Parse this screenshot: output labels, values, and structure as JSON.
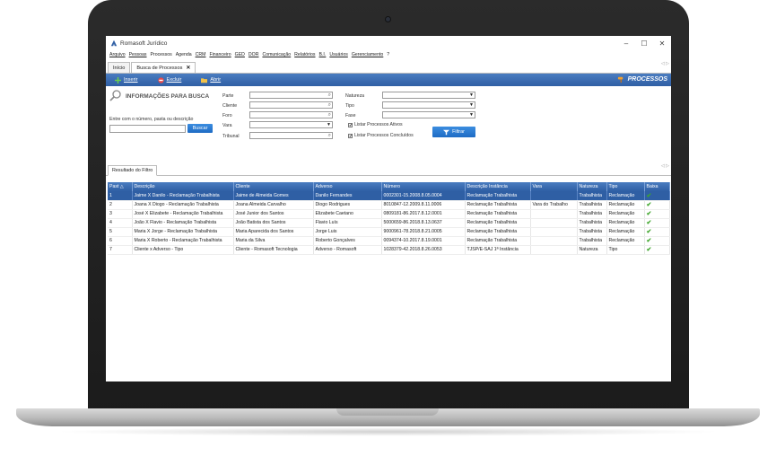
{
  "app": {
    "title": "Romasoft Jurídico",
    "window_buttons": [
      "–",
      "☐",
      "✕"
    ]
  },
  "menu": [
    "Arquivo",
    "Pessoas",
    "Processos",
    "Agenda",
    "CRM",
    "Financeiro",
    "GED",
    "DOR",
    "Comunicação",
    "Relatórios",
    "B.I.",
    "Usuários",
    "Gerenciamento",
    "?"
  ],
  "tabs": {
    "home": "Início",
    "active": "Busca de Processos",
    "close": "✕",
    "arrows": "◁ ▷"
  },
  "toolbar": {
    "insert": "Inserir",
    "delete": "Excluir",
    "open": "Abrir",
    "module": "PROCESSOS"
  },
  "search": {
    "title": "INFORMAÇÕES PARA BUSCA",
    "hint": "Entre com o número, pasta ou descrição",
    "button": "Buscar",
    "labels": {
      "parte": "Parte",
      "cliente": "Cliente",
      "foro": "Foro",
      "vara": "Vara",
      "tribunal": "Tribunal",
      "natureza": "Natureza",
      "tipo": "Tipo",
      "fase": "Fase"
    },
    "check_active": "Listar Processos Ativos",
    "check_done": "Listar Processos Concluídos",
    "check_mark": "✔",
    "filter": "Filtrar"
  },
  "results": {
    "tab": "Resultado do Filtro",
    "arrows": "◁ ▷",
    "columns": [
      "Past  △",
      "Descrição",
      "Cliente",
      "Adverso",
      "Número",
      "Descrição Instância",
      "Vara",
      "Natureza",
      "Tipo",
      "Baixa"
    ],
    "rows": [
      [
        "1",
        "Jaime X Danilo - Reclamação Trabalhista",
        "Jaime de Almeida Gomes",
        "Danilo Fernandes",
        "0002301-15.2008.8.05.0004",
        "Reclamação Trabalhista",
        "",
        "Trabalhista",
        "Reclamação",
        "✔"
      ],
      [
        "2",
        "Joana X Diogo - Reclamação Trabalhista",
        "Joana Almeida Carvalho",
        "Diogo Rodrigues",
        "8010847-12.2009.8.11.0006",
        "Reclamação Trabalhista",
        "Vara do Trabalho",
        "Trabalhista",
        "Reclamação",
        "✔"
      ],
      [
        "3",
        "José X Elizabete - Reclamação Trabalhista",
        "José Junior dos Santos",
        "Elizabete Caetano",
        "0809181-86.2017.8.12.0001",
        "Reclamação Trabalhista",
        "",
        "Trabalhista",
        "Reclamação",
        "✔"
      ],
      [
        "4",
        "João X Flavio - Reclamação Trabalhista",
        "João Batista dos Santos",
        "Flavio Luís",
        "5000659-86.2018.8.13.0637",
        "Reclamação Trabalhista",
        "",
        "Trabalhista",
        "Reclamação",
        "✔"
      ],
      [
        "5",
        "Maria X Jorge - Reclamação Trabalhista",
        "Maria Aparecida dos Santos",
        "Jorge Luis",
        "9000961-78.2018.8.21.0005",
        "Reclamação Trabalhista",
        "",
        "Trabalhista",
        "Reclamação",
        "✔"
      ],
      [
        "6",
        "Maria X Roberto - Reclamação Trabalhista",
        "Maria da Silva",
        "Roberto Gonçalves",
        "0094374-10.2017.8.19.0001",
        "Reclamação Trabalhista",
        "",
        "Trabalhista",
        "Reclamação",
        "✔"
      ],
      [
        "7",
        "Cliente x Adverso - Tipo",
        "Cliente - Romasoft Tecnologia",
        "Adverso - Romasoft",
        "1028379-42.2018.8.26.0053",
        "TJSP/E-SAJ 1ª Instância",
        "",
        "Natureza",
        "Tipo",
        "✔"
      ]
    ]
  },
  "colors": {
    "toolbar": "#2f5fa4",
    "selected_row": "#2f5fa4",
    "button": "#1e6bc4",
    "check": "#3ea52b"
  }
}
